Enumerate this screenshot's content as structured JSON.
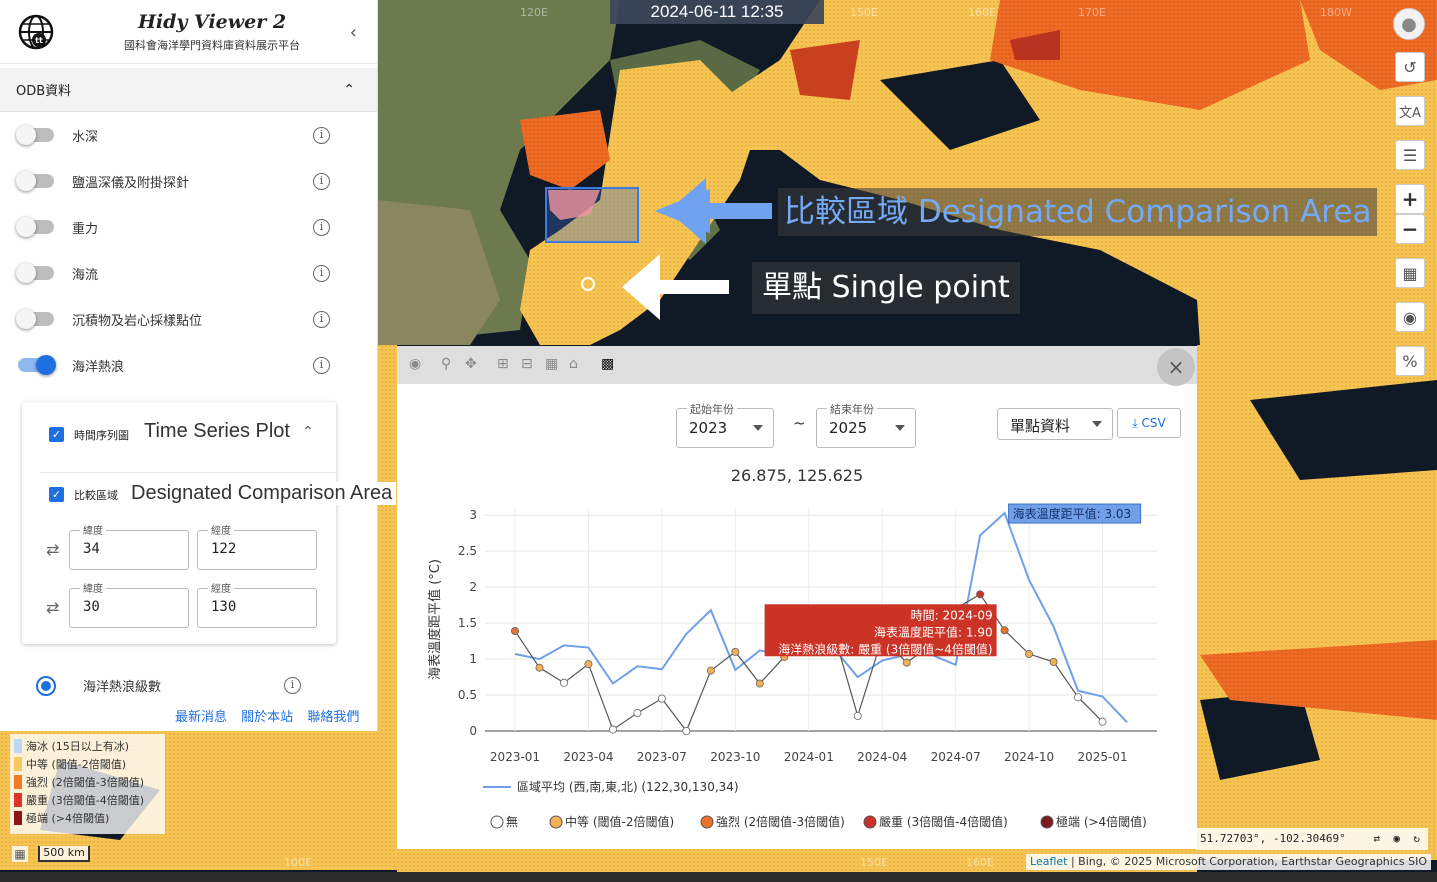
{
  "map": {
    "datetime": "2024-06-11 12:35",
    "lon_labels": [
      "120E",
      "150E",
      "160E",
      "170E",
      "180W"
    ],
    "lon_labels_bottom": [
      "100E",
      "150E",
      "160E"
    ],
    "annotation_area": "比較區域 Designated Comparison Area",
    "annotation_point": "單點 Single point",
    "scale": "500 km",
    "coords": "51.72703°, -102.30469°",
    "attribution_leaflet": "Leaflet",
    "attribution_rest": " | Bing, © 2025 Microsoft Corporation, Earthstar Geographics SIO",
    "controls": [
      "share-icon",
      "translate-icon",
      "layers-icon",
      "zoom-in-icon",
      "zoom-out-icon",
      "plan-icon",
      "camera-icon",
      "percent-icon"
    ],
    "zoom_in": "+",
    "zoom_out": "−"
  },
  "legend": [
    {
      "label": "海冰 (15日以上有冰)",
      "color": "#bcd8f5"
    },
    {
      "label": "中等 (閾值-2倍閾值)",
      "color": "#f7c85f"
    },
    {
      "label": "強烈 (2倍閾值-3倍閾值)",
      "color": "#f07a26"
    },
    {
      "label": "嚴重 (3倍閾值-4倍閾值)",
      "color": "#d8362a"
    },
    {
      "label": "極端 (>4倍閾值)",
      "color": "#8c1515"
    }
  ],
  "sidebar": {
    "title": "Hidy Viewer 2",
    "subtitle": "國科會海洋學門資料庫資料展示平台",
    "section": "ODB資料",
    "layers": [
      {
        "label": "水深",
        "on": false
      },
      {
        "label": "鹽溫深儀及附掛探針",
        "on": false
      },
      {
        "label": "重力",
        "on": false
      },
      {
        "label": "海流",
        "on": false
      },
      {
        "label": "沉積物及岩心採樣點位",
        "on": false
      },
      {
        "label": "海洋熱浪",
        "on": true
      }
    ],
    "timeseries_small": "時間序列圖",
    "timeseries_big": "Time Series Plot",
    "compare_small": "比較區域",
    "compare_big": "Designated Comparison Area",
    "lat_label": "緯度",
    "lon_label": "經度",
    "lat1": "34",
    "lon1": "122",
    "lat2": "30",
    "lon2": "130",
    "heat_level": "海洋熱浪級數",
    "footer": [
      "最新消息",
      "關於本站",
      "聯絡我們"
    ]
  },
  "chart": {
    "start_caption": "起始年份",
    "start_year": "2023",
    "end_caption": "結束年份",
    "end_year": "2025",
    "tilde": "~",
    "mode": "單點資料",
    "csv": "CSV",
    "point": "26.875, 125.625",
    "close": "×"
  },
  "chart_data": {
    "type": "line",
    "ylabel": "海表溫度距平值 (°C)",
    "ylim": [
      0,
      3.1
    ],
    "yticks": [
      0,
      0.5,
      1,
      1.5,
      2,
      2.5,
      3
    ],
    "x": [
      "2023-01",
      "2023-02",
      "2023-03",
      "2023-04",
      "2023-05",
      "2023-06",
      "2023-07",
      "2023-08",
      "2023-09",
      "2023-10",
      "2023-11",
      "2023-12",
      "2024-01",
      "2024-02",
      "2024-03",
      "2024-04",
      "2024-05",
      "2024-06",
      "2024-07",
      "2024-08",
      "2024-09",
      "2024-10",
      "2024-11",
      "2024-12",
      "2025-01",
      "2025-02"
    ],
    "xtick_labels": [
      "2023-01",
      "2023-04",
      "2023-07",
      "2023-10",
      "2024-01",
      "2024-04",
      "2024-07",
      "2024-10",
      "2025-01"
    ],
    "series": [
      {
        "name": "區域平均 (西,南,東,北) (122,30,130,34)",
        "color": "#6fa0e8",
        "values": [
          1.07,
          1.0,
          1.19,
          1.16,
          0.66,
          0.9,
          0.86,
          1.35,
          1.68,
          0.85,
          1.12,
          1.05,
          1.2,
          1.16,
          0.75,
          0.98,
          1.06,
          1.06,
          0.92,
          2.72,
          3.03,
          2.1,
          1.45,
          0.56,
          0.48,
          0.12
        ]
      },
      {
        "name": "單點",
        "color": "#555555",
        "values": [
          1.39,
          0.88,
          0.67,
          0.93,
          0.02,
          0.25,
          0.45,
          0.0,
          0.84,
          1.1,
          0.66,
          1.03,
          1.18,
          1.39,
          0.21,
          1.3,
          0.95,
          1.2,
          1.7,
          1.9,
          1.4,
          1.07,
          0.96,
          0.47,
          0.13,
          null
        ],
        "levels": [
          "strong",
          "moderate",
          "none",
          "moderate",
          "none",
          "none",
          "none",
          "none",
          "moderate",
          "moderate",
          "moderate",
          "moderate",
          "moderate",
          "moderate",
          "none",
          "moderate",
          "moderate",
          "strong",
          "severe",
          "severe",
          "strong",
          "moderate",
          "moderate",
          "none",
          "none",
          null
        ]
      }
    ],
    "level_colors": {
      "none": "#ffffff",
      "moderate": "#f2b055",
      "strong": "#e8732a",
      "severe": "#cc3327",
      "extreme": "#7d1a1a"
    },
    "legend": [
      {
        "key": "none",
        "label": "無"
      },
      {
        "key": "moderate",
        "label": "中等 (閾值-2倍閾值)"
      },
      {
        "key": "strong",
        "label": "強烈 (2倍閾值-3倍閾值)"
      },
      {
        "key": "severe",
        "label": "嚴重 (3倍閾值-4倍閾值)"
      },
      {
        "key": "extreme",
        "label": "極端 (>4倍閾值)"
      }
    ],
    "tooltip_single": [
      "時間: 2024-09",
      "海表溫度距平值: 1.90",
      "海洋熱浪級數: 嚴重 (3倍閾值~4倍閾值)"
    ],
    "tooltip_area": "海表溫度距平值: 3.03"
  }
}
